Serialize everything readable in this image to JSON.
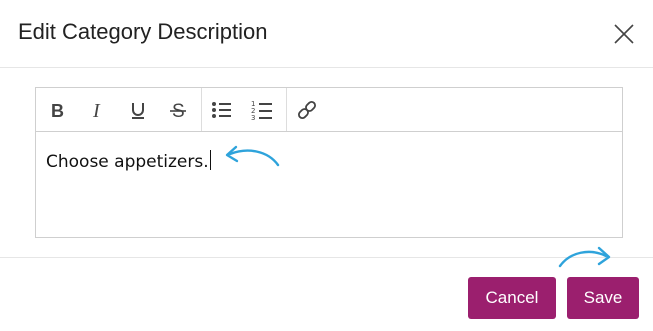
{
  "dialog": {
    "title": "Edit Category Description"
  },
  "toolbar": {
    "buttons": [
      {
        "name": "bold",
        "icon": "bold-icon"
      },
      {
        "name": "italic",
        "icon": "italic-icon"
      },
      {
        "name": "underline",
        "icon": "underline-icon"
      },
      {
        "name": "strikethrough",
        "icon": "strikethrough-icon"
      },
      {
        "name": "bulleted-list",
        "icon": "bulleted-list-icon"
      },
      {
        "name": "numbered-list",
        "icon": "numbered-list-icon"
      },
      {
        "name": "link",
        "icon": "link-icon"
      }
    ]
  },
  "editor": {
    "text": "Choose appetizers."
  },
  "footer": {
    "cancel_label": "Cancel",
    "save_label": "Save"
  },
  "colors": {
    "primary_button": "#9b1f6e",
    "annotation_arrow": "#2ea3db"
  }
}
